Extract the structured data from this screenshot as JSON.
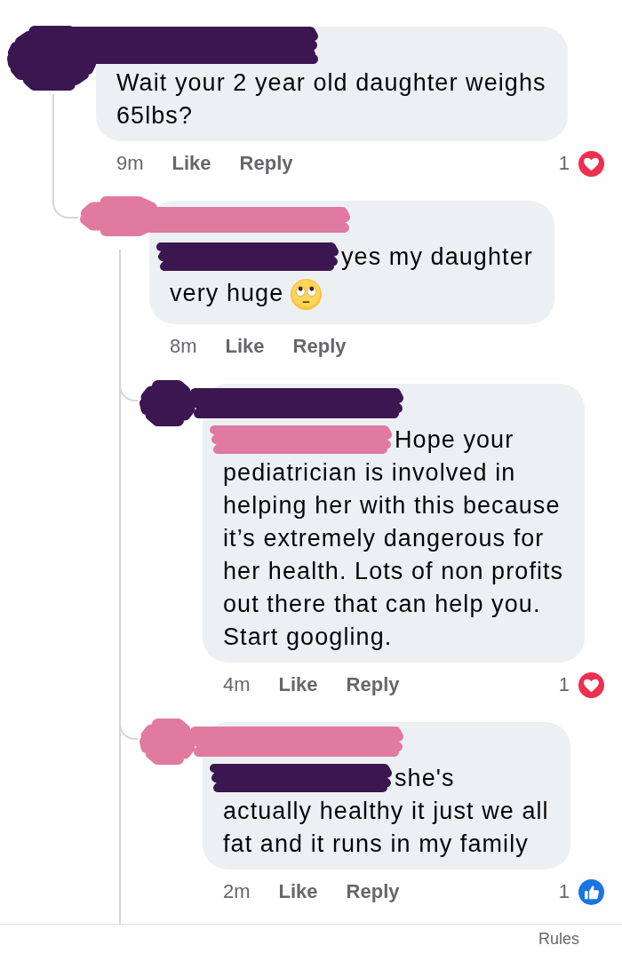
{
  "comments": [
    {
      "author": {
        "color": "#3c1650"
      },
      "lines": [
        "Wait your 2 year old daughter weighs",
        "65lbs?"
      ],
      "time": "9m",
      "like": "Like",
      "reply": "Reply",
      "reaction": {
        "kind": "love",
        "count": "1"
      },
      "thread_continues": false,
      "replies": [
        {
          "author": {
            "color": "#e07a9f"
          },
          "mention": {
            "color": "#3c1650"
          },
          "lines": [
            "yes my daughter",
            "very huge"
          ],
          "end_emoji": {
            "kind": "eye_roll"
          },
          "time": "8m",
          "like": "Like",
          "reply": "Reply",
          "thread_continues": true,
          "replies": [
            {
              "author": {
                "color": "#3c1650"
              },
              "mention": {
                "color": "#e07a9f"
              },
              "lines": [
                "Hope your",
                "pediatrician is involved in",
                "helping her with this because",
                "it’s extremely dangerous for",
                "her health. Lots of non profits",
                "out there that can help you.",
                "Start googling."
              ],
              "time": "4m",
              "like": "Like",
              "reply": "Reply",
              "reaction": {
                "kind": "love",
                "count": "1"
              }
            },
            {
              "author": {
                "color": "#e07a9f"
              },
              "mention": {
                "color": "#3c1650"
              },
              "lines": [
                "she's",
                "actually healthy it just we all",
                "fat and it runs in my family"
              ],
              "time": "2m",
              "like": "Like",
              "reply": "Reply",
              "reaction": {
                "kind": "like",
                "count": "1"
              }
            }
          ]
        }
      ]
    }
  ],
  "footer": {
    "link": "Rules"
  }
}
